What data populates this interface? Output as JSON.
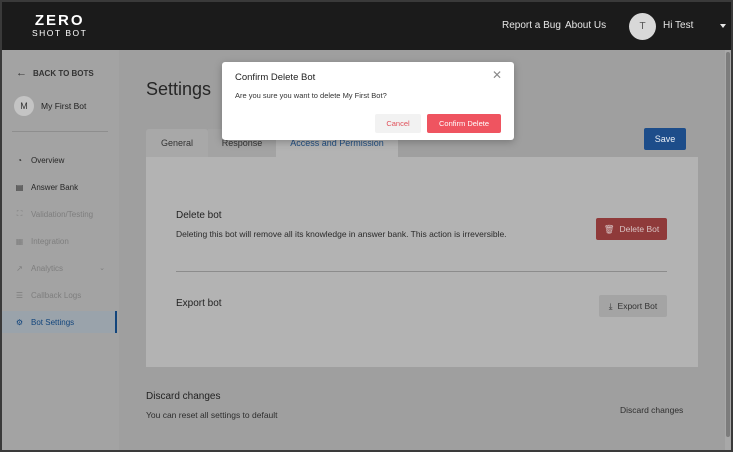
{
  "header": {
    "logo_line1": "ZERO",
    "logo_line2": "SHOT BOT",
    "report_bug": "Report a Bug",
    "about_us": "About Us",
    "avatar_initial": "T",
    "user_greeting": "Hi Test"
  },
  "sidebar": {
    "back_label": "BACK TO BOTS",
    "bot_initial": "M",
    "bot_name": "My First Bot",
    "items": [
      {
        "label": "Overview",
        "icon": "gauge-icon",
        "state": "enabled"
      },
      {
        "label": "Answer Bank",
        "icon": "book-icon",
        "state": "enabled"
      },
      {
        "label": "Validation/Testing",
        "icon": "scan-icon",
        "state": "disabled"
      },
      {
        "label": "Integration",
        "icon": "grid-icon",
        "state": "disabled"
      },
      {
        "label": "Analytics",
        "icon": "trend-icon",
        "state": "disabled"
      },
      {
        "label": "Callback Logs",
        "icon": "list-icon",
        "state": "disabled"
      },
      {
        "label": "Bot Settings",
        "icon": "gear-icon",
        "state": "active"
      }
    ]
  },
  "main": {
    "title": "Settings",
    "tabs": [
      "General",
      "Response",
      "Access and Permission"
    ],
    "active_tab": "Access and Permission",
    "save_label": "Save",
    "delete_section": {
      "title": "Delete bot",
      "description": "Deleting this bot will remove all its knowledge in answer bank. This action is irreversible.",
      "button": "Delete Bot"
    },
    "export_section": {
      "title": "Export bot",
      "button": "Export Bot"
    },
    "discard_section": {
      "title": "Discard changes",
      "description": "You can reset all settings to default",
      "button": "Discard changes"
    }
  },
  "modal": {
    "title": "Confirm Delete Bot",
    "body": "Are you sure you want to delete My First Bot?",
    "cancel_label": "Cancel",
    "confirm_label": "Confirm Delete"
  },
  "colors": {
    "navbar": "#1b1b1b",
    "accent_blue": "#1d6fd8",
    "danger_red": "#ef5460",
    "overlay": "rgba(0,0,0,0.38)"
  }
}
